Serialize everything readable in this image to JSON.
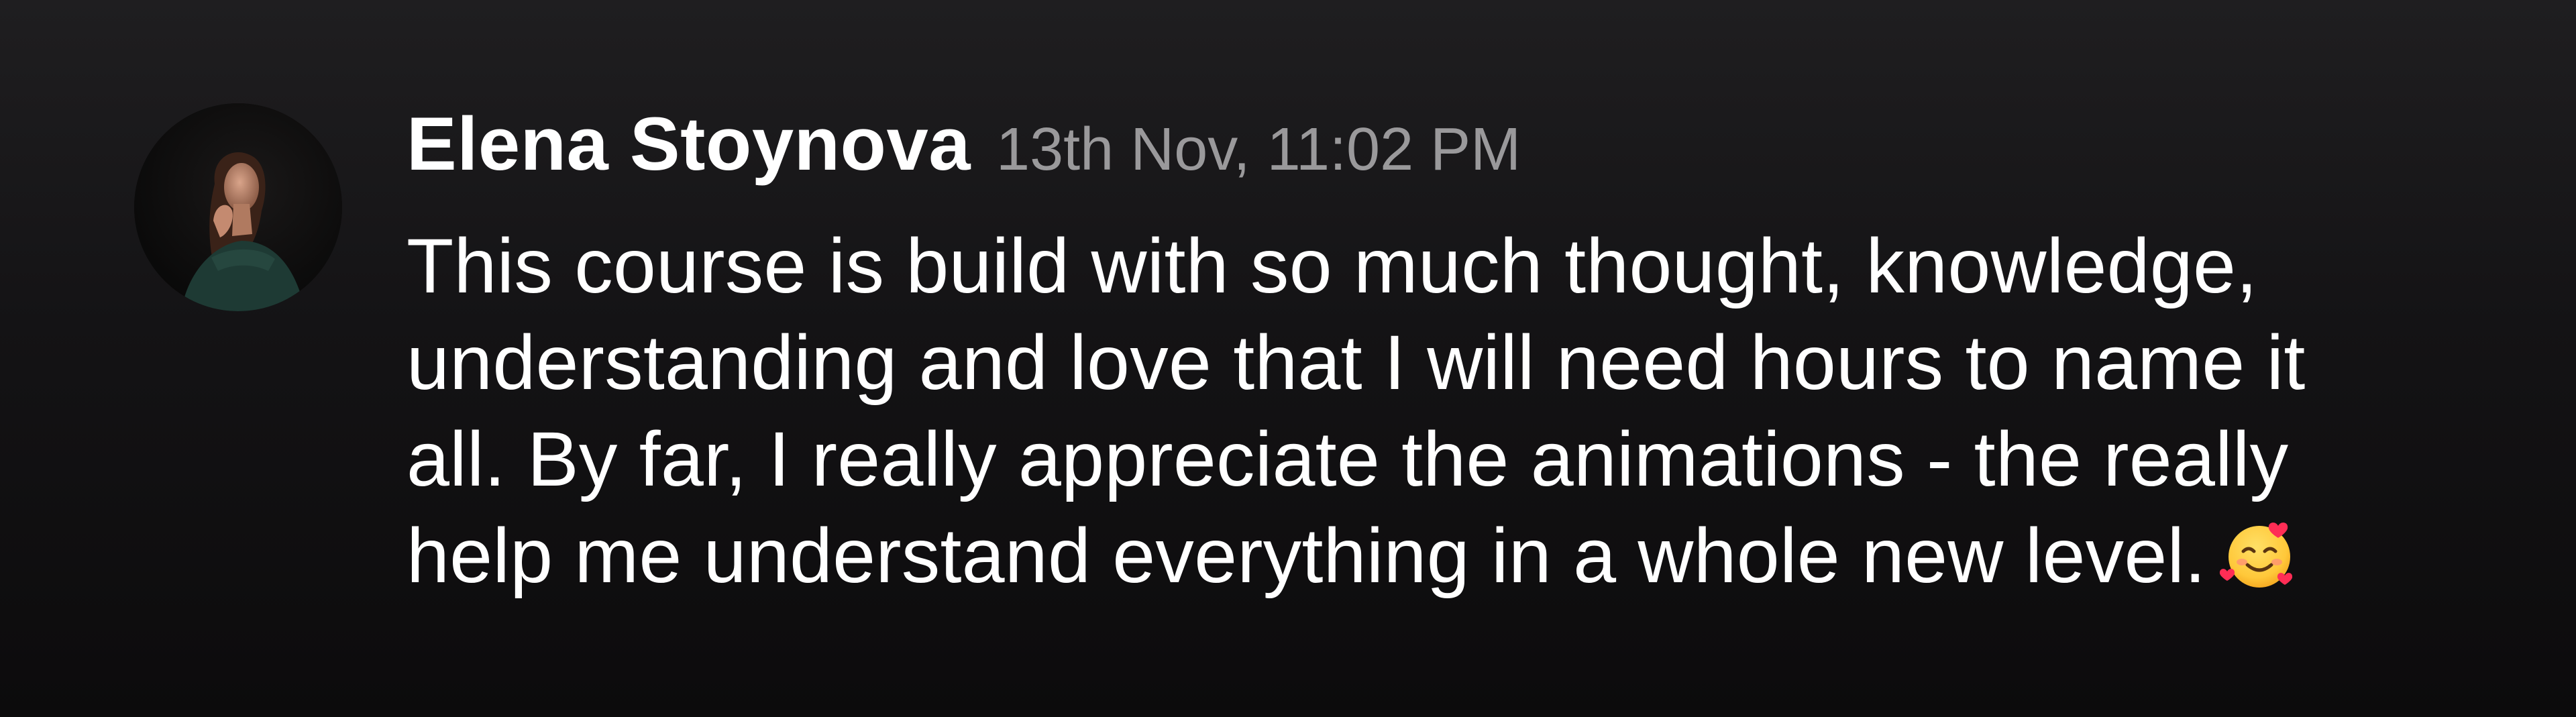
{
  "message": {
    "author": "Elena Stoynova",
    "timestamp": "13th Nov, 11:02 PM",
    "lines": [
      "This course is build with so much thought, knowledge,",
      "understanding and love that I will need hours to name it",
      "all. By far, I really appreciate the animations - the really",
      "help me understand everything in a whole new level."
    ],
    "emoji": "smiling-face-with-hearts-icon"
  },
  "colors": {
    "background_top": "#1f1e20",
    "background_bottom": "#0c0b0c",
    "author_text": "#ffffff",
    "timestamp_text": "#9a999b",
    "body_text": "#ffffff"
  }
}
